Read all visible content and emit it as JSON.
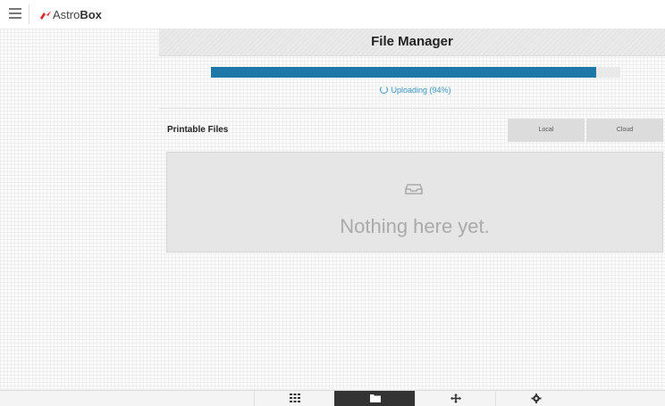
{
  "header": {
    "brand_light": "Astro",
    "brand_bold": "Box",
    "brand_color": "#e2262c",
    "menu_icon": "hamburger-icon"
  },
  "page": {
    "title": "File Manager"
  },
  "upload": {
    "progress": 0.94,
    "status_text": "Uploading (94%)",
    "bar_color": "#1d78a8"
  },
  "files": {
    "section_title": "Printable Files",
    "tabs": [
      {
        "label": "Local"
      },
      {
        "label": "Cloud"
      }
    ],
    "empty_icon": "tray-icon",
    "empty_message": "Nothing here yet."
  },
  "bottom_nav": {
    "items": [
      {
        "icon": "grid-icon",
        "active": false
      },
      {
        "icon": "folder-icon",
        "active": true
      },
      {
        "icon": "move-icon",
        "active": false
      },
      {
        "icon": "gear-icon",
        "active": false
      }
    ]
  }
}
